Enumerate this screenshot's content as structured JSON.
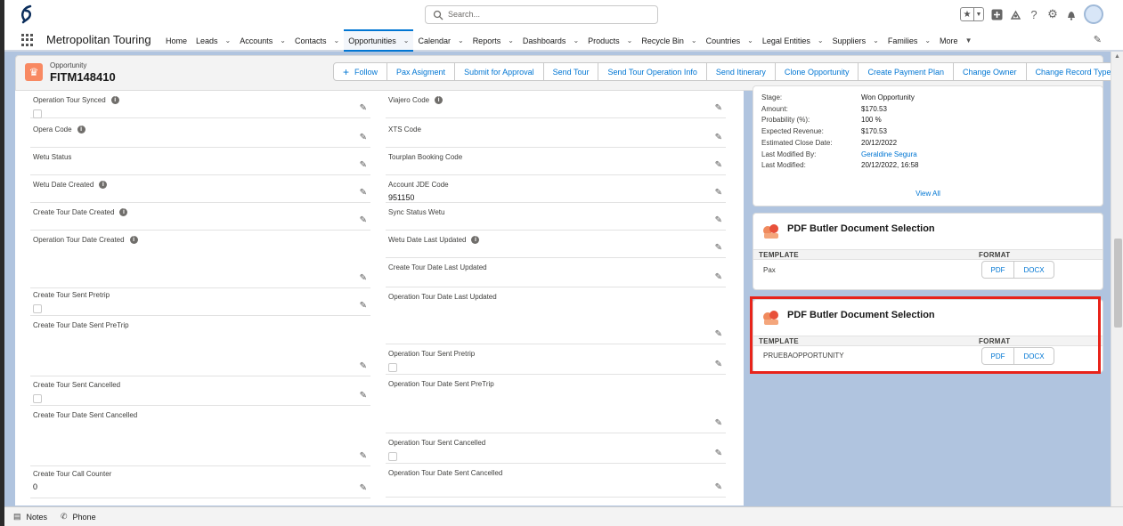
{
  "header": {
    "search_placeholder": "Search..."
  },
  "nav": {
    "app_name": "Metropolitan Touring",
    "items": [
      {
        "label": "Home",
        "has_menu": false,
        "active": false
      },
      {
        "label": "Leads",
        "has_menu": true,
        "active": false
      },
      {
        "label": "Accounts",
        "has_menu": true,
        "active": false
      },
      {
        "label": "Contacts",
        "has_menu": true,
        "active": false
      },
      {
        "label": "Opportunities",
        "has_menu": true,
        "active": true
      },
      {
        "label": "Calendar",
        "has_menu": true,
        "active": false
      },
      {
        "label": "Reports",
        "has_menu": true,
        "active": false
      },
      {
        "label": "Dashboards",
        "has_menu": true,
        "active": false
      },
      {
        "label": "Products",
        "has_menu": true,
        "active": false
      },
      {
        "label": "Recycle Bin",
        "has_menu": true,
        "active": false
      },
      {
        "label": "Countries",
        "has_menu": true,
        "active": false
      },
      {
        "label": "Legal Entities",
        "has_menu": true,
        "active": false
      },
      {
        "label": "Suppliers",
        "has_menu": true,
        "active": false
      },
      {
        "label": "Families",
        "has_menu": true,
        "active": false
      },
      {
        "label": "More",
        "has_menu": true,
        "active": false
      }
    ]
  },
  "record": {
    "type": "Opportunity",
    "name": "FITM148410",
    "actions": [
      "Follow",
      "Pax Asigment",
      "Submit for Approval",
      "Send Tour",
      "Send Tour Operation Info",
      "Send Itinerary",
      "Clone Opportunity",
      "Create Payment Plan",
      "Change Owner",
      "Change Record Type"
    ]
  },
  "left_fields": [
    {
      "label": "Operation Tour Synced",
      "info": true,
      "kind": "checkbox"
    },
    {
      "label": "Opera Code",
      "info": true,
      "value": ""
    },
    {
      "label": "Wetu Status",
      "info": false,
      "value": ""
    },
    {
      "label": "Wetu Date Created",
      "info": true,
      "value": ""
    },
    {
      "label": "Create Tour Date Created",
      "info": true,
      "value": ""
    },
    {
      "label": "Operation Tour Date Created",
      "info": true,
      "value": ""
    },
    {
      "label": "Create Tour Sent Pretrip",
      "info": false,
      "kind": "checkbox"
    },
    {
      "label": "Create Tour Date Sent PreTrip",
      "info": false,
      "value": ""
    },
    {
      "label": "Create Tour Sent Cancelled",
      "info": false,
      "kind": "checkbox"
    },
    {
      "label": "Create Tour Date Sent Cancelled",
      "info": false,
      "value": ""
    },
    {
      "label": "Create Tour Call Counter",
      "info": false,
      "value": "0"
    }
  ],
  "right_fields": [
    {
      "label": "Viajero Code",
      "info": true,
      "value": ""
    },
    {
      "label": "XTS Code",
      "info": false,
      "value": ""
    },
    {
      "label": "Tourplan Booking Code",
      "info": false,
      "value": ""
    },
    {
      "label": "Account JDE Code",
      "info": false,
      "value": "951150"
    },
    {
      "label": "Sync Status Wetu",
      "info": false,
      "value": ""
    },
    {
      "label": "Wetu Date Last Updated",
      "info": true,
      "value": ""
    },
    {
      "label": "Create Tour Date Last Updated",
      "info": false,
      "value": ""
    },
    {
      "label": "Operation Tour Date Last Updated",
      "info": false,
      "value": ""
    },
    {
      "label": "Operation Tour Sent Pretrip",
      "info": false,
      "kind": "checkbox"
    },
    {
      "label": "Operation Tour Date Sent PreTrip",
      "info": false,
      "value": ""
    },
    {
      "label": "Operation Tour Sent Cancelled",
      "info": false,
      "kind": "checkbox"
    },
    {
      "label": "Operation Tour Date Sent Cancelled",
      "info": false,
      "value": ""
    }
  ],
  "details": {
    "rows": [
      {
        "label": "Stage:",
        "value": "Won Opportunity",
        "link": false
      },
      {
        "label": "Amount:",
        "value": "$170.53",
        "link": false
      },
      {
        "label": "Probability (%):",
        "value": "100 %",
        "link": false
      },
      {
        "label": "Expected Revenue:",
        "value": "$170.53",
        "link": false
      },
      {
        "label": "Estimated Close Date:",
        "value": "20/12/2022",
        "link": false
      },
      {
        "label": "Last Modified By:",
        "value": "Geraldine Segura",
        "link": true
      },
      {
        "label": "Last Modified:",
        "value": "20/12/2022, 16:58",
        "link": false
      }
    ],
    "view_all": "View All"
  },
  "pdf_cards": [
    {
      "title": "PDF Butler Document Selection",
      "template_header": "TEMPLATE",
      "format_header": "FORMAT",
      "template": "Pax",
      "pdf_label": "PDF",
      "docx_label": "DOCX"
    },
    {
      "title": "PDF Butler Document Selection",
      "template_header": "TEMPLATE",
      "format_header": "FORMAT",
      "template": "PRUEBAOPPORTUNITY",
      "pdf_label": "PDF",
      "docx_label": "DOCX"
    }
  ],
  "utility": {
    "notes": "Notes",
    "phone": "Phone"
  },
  "colors": {
    "accent": "#0176d3",
    "highlight": "#e8231a",
    "record_icon": "#f88962"
  }
}
